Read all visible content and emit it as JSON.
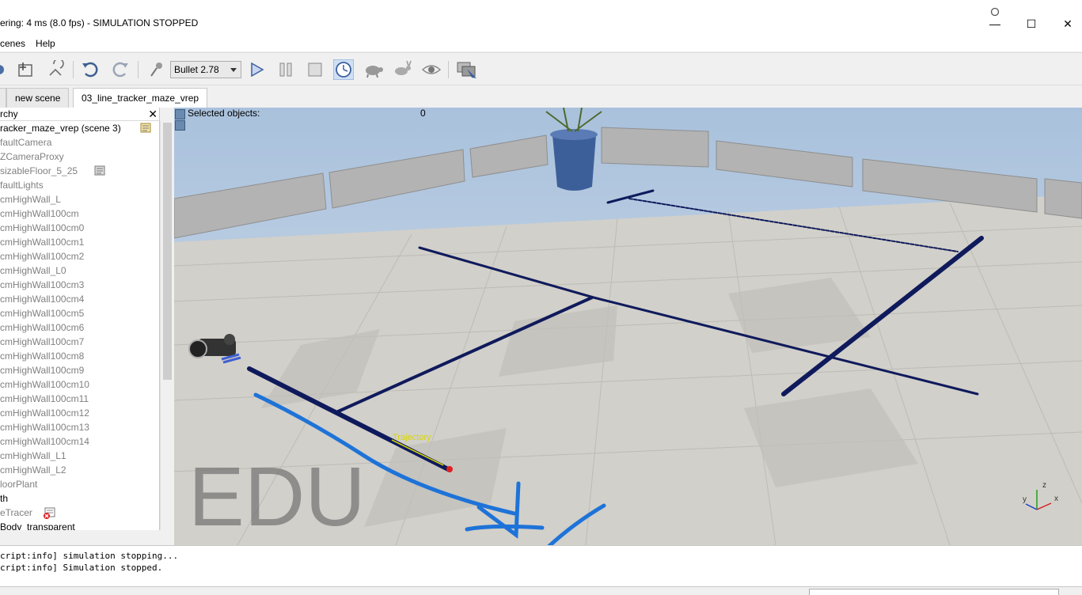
{
  "window": {
    "title": "ering: 4 ms (8.0 fps) - SIMULATION STOPPED",
    "controls": {
      "minimize": "—",
      "maximize": "☐",
      "close": "✕"
    }
  },
  "menu": {
    "items": [
      "cenes",
      "Help"
    ]
  },
  "toolbar": {
    "engine": "Bullet 2.78"
  },
  "tabs": [
    {
      "label": "new scene"
    },
    {
      "label": "03_line_tracker_maze_vrep"
    }
  ],
  "hierarchy": {
    "title": "rchy",
    "close_glyph": "✕",
    "items": [
      "racker_maze_vrep (scene 3)",
      "faultCamera",
      "ZCameraProxy",
      "sizableFloor_5_25",
      "faultLights",
      "cmHighWall_L",
      "cmHighWall100cm",
      "cmHighWall100cm0",
      "cmHighWall100cm1",
      "cmHighWall100cm2",
      "cmHighWall_L0",
      "cmHighWall100cm3",
      "cmHighWall100cm4",
      "cmHighWall100cm5",
      "cmHighWall100cm6",
      "cmHighWall100cm7",
      "cmHighWall100cm8",
      "cmHighWall100cm9",
      "cmHighWall100cm10",
      "cmHighWall100cm11",
      "cmHighWall100cm12",
      "cmHighWall100cm13",
      "cmHighWall100cm14",
      "cmHighWall_L1",
      "cmHighWall_L2",
      "loorPlant",
      "th",
      "eTracer",
      "Body_transparent"
    ]
  },
  "viewport": {
    "selected_label": "Selected objects:",
    "selected_count": "0",
    "watermark": "EDU",
    "trajectory_label": "Trajectory",
    "axis_x": "x",
    "axis_y": "y",
    "axis_z": "z"
  },
  "console": {
    "lines": [
      "cript:info] simulation stopping...",
      "cript:info] Simulation stopped."
    ]
  },
  "colors": {
    "sky": "#c9d6e6",
    "floor_light": "#d8d6d0",
    "floor_dark": "#c4c2bc",
    "track": "#0f1a5c",
    "annotation": "#1e73d8",
    "pot": "#3d5f99"
  }
}
